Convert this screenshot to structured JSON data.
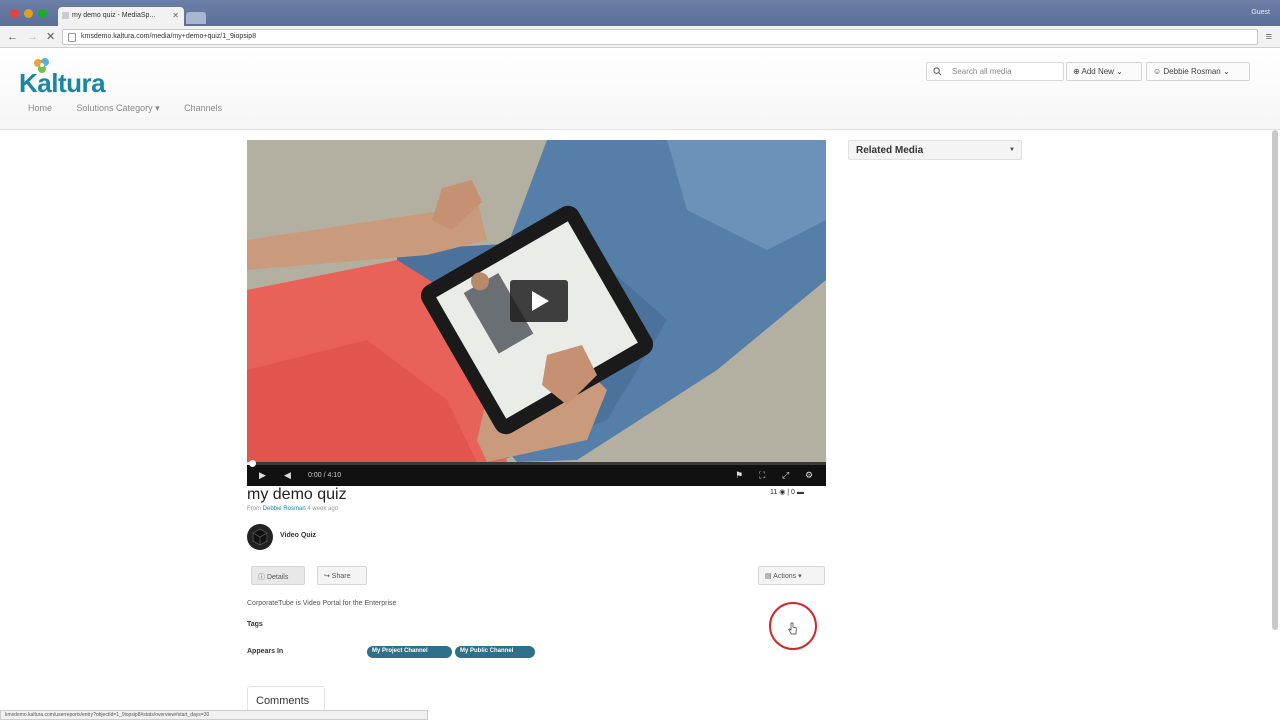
{
  "browser": {
    "tab_title": "my demo quiz - MediaSp...",
    "guest_label": "Guest",
    "url": "kmsdemo.kaltura.com/media/my+demo+quiz/1_9iopsip8"
  },
  "header": {
    "logo_text": "Kaltura",
    "nav": [
      "Home",
      "Solutions Category ▾",
      "Channels"
    ],
    "search_placeholder": "Search all media",
    "add_new_label": "⊕ Add New ⌄",
    "user_label": "☺ Debbie Rosman ⌄"
  },
  "player": {
    "time": "0:00 / 4:10",
    "progress": 0.01
  },
  "media": {
    "title": "my demo quiz",
    "from_prefix": "From",
    "author": "Debbie Rosman",
    "ago": "4 week ago",
    "stats": "11 ◉ | 0 ▬",
    "type_label": "Video Quiz",
    "details_label": "ⓘ Details",
    "share_label": "↪ Share",
    "actions_label": "▤ Actions ▾",
    "description": "CorporateTube is Video Portal for the Enterprise",
    "tags_label": "Tags",
    "appears_label": "Appears In",
    "channels": [
      "My Project Channel",
      "My Public Channel"
    ],
    "comments_label": "Comments"
  },
  "sidebar": {
    "related_label": "Related Media"
  },
  "statusbar": {
    "text": "kmsdemo.kaltura.com/userreports/entry?objectId=1_9iopsip8#stats/overview#start_days=30"
  },
  "colors": {
    "brand": "#1a86a6",
    "channel_pill": "#2e6f89",
    "click_ring": "#cf2a2a"
  }
}
